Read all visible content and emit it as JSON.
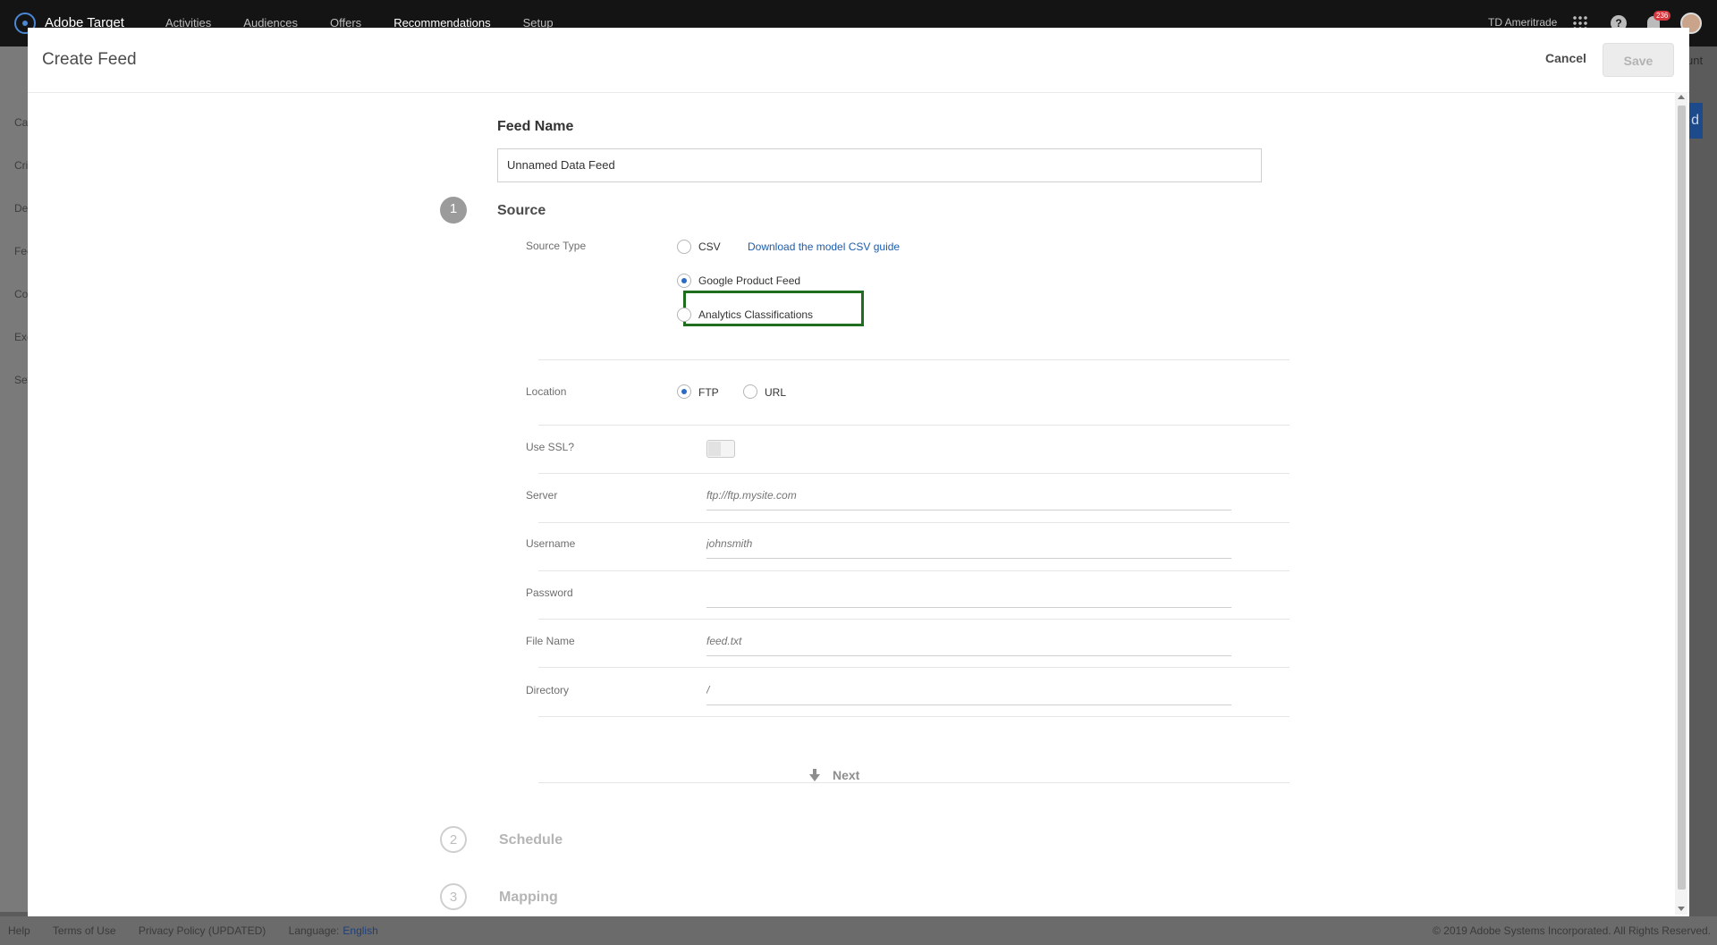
{
  "app": {
    "brand": "Adobe Target",
    "nav": [
      "Activities",
      "Audiences",
      "Offers",
      "Recommendations",
      "Setup"
    ],
    "org": "TD Ameritrade",
    "notification_count": "236",
    "help_label": "?"
  },
  "leftnav": [
    "Cat",
    "Cri",
    "De",
    "Fee",
    "Co",
    "Exc",
    "Set"
  ],
  "background": {
    "right_text": "unt",
    "right_button": "d"
  },
  "modal": {
    "title": "Create Feed",
    "cancel_label": "Cancel",
    "save_label": "Save",
    "feed_name_label": "Feed Name",
    "feed_name_value": "Unnamed Data Feed",
    "steps": [
      {
        "number": "1",
        "title": "Source"
      },
      {
        "number": "2",
        "title": "Schedule"
      },
      {
        "number": "3",
        "title": "Mapping"
      }
    ],
    "source_type": {
      "label": "Source Type",
      "options": [
        "CSV",
        "Google Product Feed",
        "Analytics Classifications"
      ],
      "selected": "Google Product Feed",
      "csv_guide_link": "Download the model CSV guide"
    },
    "location": {
      "label": "Location",
      "options": [
        "FTP",
        "URL"
      ],
      "selected": "FTP"
    },
    "ssl_label": "Use SSL?",
    "fields": {
      "server": {
        "label": "Server",
        "placeholder": "ftp://ftp.mysite.com"
      },
      "username": {
        "label": "Username",
        "placeholder": "johnsmith"
      },
      "password": {
        "label": "Password",
        "placeholder": ""
      },
      "file_name": {
        "label": "File Name",
        "placeholder": "feed.txt"
      },
      "directory": {
        "label": "Directory",
        "placeholder": "/"
      }
    },
    "next_label": "Next"
  },
  "footer": {
    "links": [
      "Help",
      "Terms of Use",
      "Privacy Policy (UPDATED)"
    ],
    "language_label": "Language:",
    "language_value": "English",
    "copyright": "© 2019 Adobe Systems Incorporated. All Rights Reserved."
  },
  "colors": {
    "accent": "#2d6bc3",
    "highlight": "#1e6e1e",
    "link": "#1e5cad"
  }
}
